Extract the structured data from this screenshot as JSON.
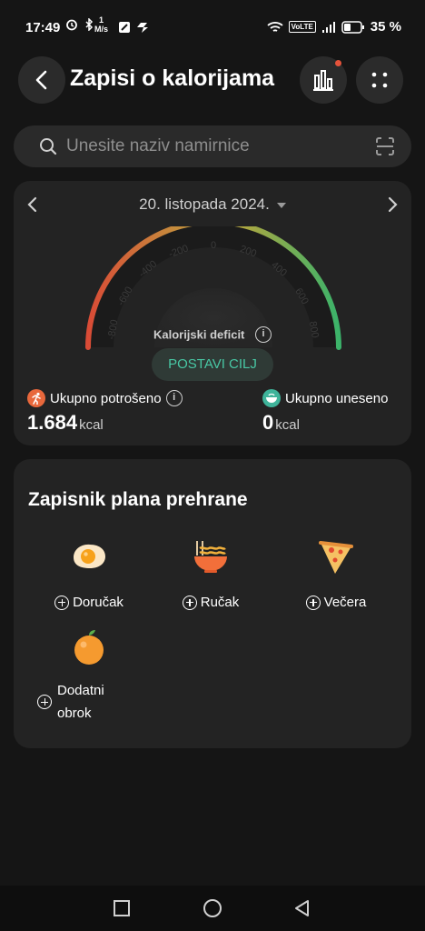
{
  "status_bar": {
    "time": "17:49",
    "speed_top": "1",
    "speed_bottom": "M/s",
    "volte": "VoLTE",
    "battery": "35 %"
  },
  "header": {
    "title": "Zapisi o kalorijama"
  },
  "search": {
    "placeholder": "Unesite naziv namirnice"
  },
  "calorie_card": {
    "date": "20. listopada 2024.",
    "gauge_ticks": [
      "-800",
      "-600",
      "-400",
      "-200",
      "0",
      "200",
      "400",
      "600",
      "800"
    ],
    "deficit_label": "Kalorijski deficit",
    "set_goal_button": "POSTAVI CILJ",
    "burned_label": "Ukupno potrošeno",
    "burned_value": "1.684",
    "burned_unit": "kcal",
    "intake_label": "Ukupno uneseno",
    "intake_value": "0",
    "intake_unit": "kcal"
  },
  "meal_plan": {
    "title": "Zapisnik plana prehrane",
    "meals": [
      {
        "label": "Doručak",
        "icon": "egg-icon"
      },
      {
        "label": "Ručak",
        "icon": "noodle-bowl-icon"
      },
      {
        "label": "Večera",
        "icon": "pizza-icon"
      },
      {
        "label": "Dodatni obrok",
        "icon": "orange-icon"
      }
    ],
    "extra_line1": "Dodatni",
    "extra_line2": "obrok"
  },
  "colors": {
    "accent": "#48c7a4",
    "background": "#151515",
    "card": "#232323",
    "burned_badge": "#e8683c",
    "intake_badge": "#3fb39a"
  }
}
